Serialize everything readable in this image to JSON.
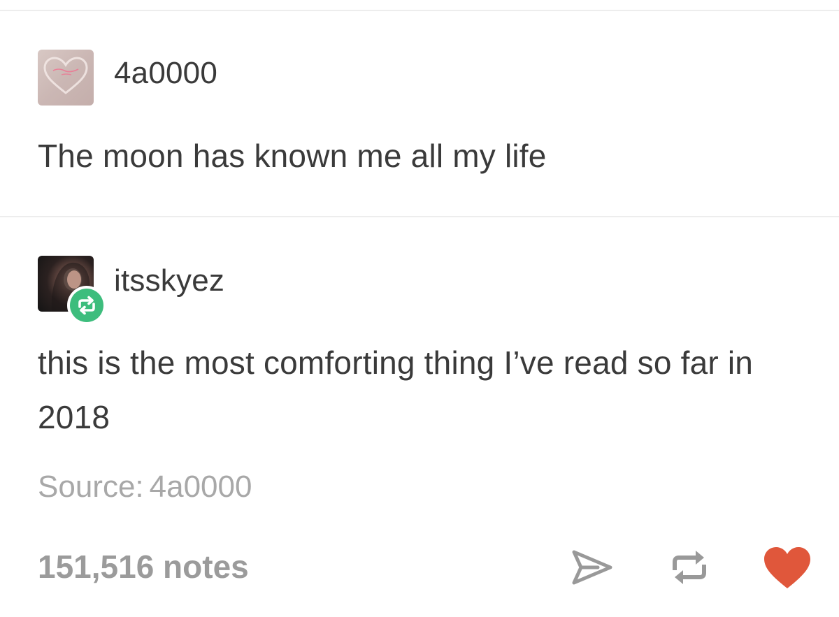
{
  "posts": [
    {
      "username": "4a0000",
      "avatar": "heart-neon-avatar",
      "text": "The moon has known me all my life"
    },
    {
      "username": "itsskyez",
      "avatar": "portrait-avatar",
      "badge_icon": "reblog-icon",
      "text": "this is the most comforting thing I’ve read so far in 2018"
    }
  ],
  "source": {
    "label": "Source:",
    "name": "4a0000"
  },
  "footer": {
    "notes": "151,516 notes",
    "actions": [
      "share-icon",
      "reblog-icon",
      "heart-icon"
    ]
  },
  "colors": {
    "text": "#3a3a3a",
    "muted": "#a8a8a8",
    "notes": "#9b9b9b",
    "reblog_green": "#3dbd7d",
    "like_red": "#e0573b",
    "icon_gray": "#999999"
  }
}
